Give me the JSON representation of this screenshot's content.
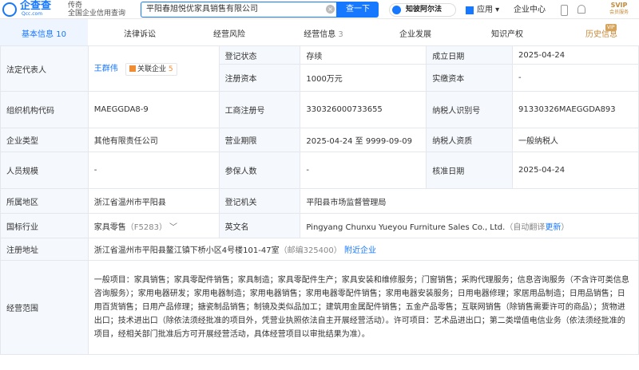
{
  "header": {
    "logo_text": "企查查",
    "logo_sub": "Qcc.com",
    "slogan_1": "传奇",
    "slogan_2": "全国企业信用查询",
    "search_value": "平阳春旭悦优家具销售有限公司",
    "clear_icon": "clear-icon",
    "search_button": "查一下",
    "law_button": "知彼阿尔法",
    "apps_label": "应用",
    "enterprise_center": "企业中心",
    "svip_line1": "SVIP",
    "svip_line2": "会员服务",
    "brand_color": "#1677ff"
  },
  "tabs": [
    {
      "label": "基本信息",
      "count": "10"
    },
    {
      "label": "法律诉讼",
      "count": ""
    },
    {
      "label": "经营风险",
      "count": ""
    },
    {
      "label": "经营信息",
      "count": "3"
    },
    {
      "label": "企业发展",
      "count": ""
    },
    {
      "label": "知识产权",
      "count": ""
    },
    {
      "label": "历史信息",
      "count": ""
    }
  ],
  "vip_badge": "VIP",
  "info": {
    "legal_rep_label": "法定代表人",
    "legal_rep_name": "王群伟",
    "related_label": "关联企业",
    "related_count": "5",
    "status_label": "登记状态",
    "status_value": "存续",
    "est_date_label": "成立日期",
    "est_date_value": "2025-04-24",
    "capital_label": "注册资本",
    "capital_value": "1000万元",
    "paid_label": "实缴资本",
    "paid_value": "-",
    "org_code_label": "组织机构代码",
    "org_code_value": "MAEGGDA8-9",
    "reg_no_label": "工商注册号",
    "reg_no_value": "330326000733655",
    "tax_id_label": "纳税人识别号",
    "tax_id_value": "91330326MAEGGDA893",
    "type_label": "企业类型",
    "type_value": "其他有限责任公司",
    "term_label": "营业期限",
    "term_value": "2025-04-24 至 9999-09-09",
    "tax_qual_label": "纳税人资质",
    "tax_qual_value": "一般纳税人",
    "staff_label": "人员规模",
    "staff_value": "-",
    "insured_label": "参保人数",
    "insured_value": "-",
    "approve_label": "核准日期",
    "approve_value": "2025-04-24",
    "region_label": "所属地区",
    "region_value": "浙江省温州市平阳县",
    "authority_label": "登记机关",
    "authority_value": "平阳县市场监督管理局",
    "industry_label": "国标行业",
    "industry_value": "家具零售",
    "industry_code": "（F5283）",
    "en_name_label": "英文名",
    "en_name_value": "Pingyang Chunxu Yueyou Furniture Sales Co., Ltd.",
    "auto_translate": "（自动翻译更新）",
    "address_label": "注册地址",
    "address_value": "浙江省温州市平阳县鳌江镇下桥小区4号楼101-47室",
    "postcode": "（邮编325400）",
    "nearby": "附近企业",
    "scope_label": "经营范围",
    "scope_value": "一般项目：家具销售；家具零配件销售；家具制造；家具零配件生产；家具安装和维修服务；门窗销售；采购代理服务；信息咨询服务（不含许可类信息咨询服务）；家用电器研发；家用电器制造；家用电器销售；家用电器零配件销售；家用电器安装服务；日用电器修理；家居用品制造；日用品销售；日用百货销售；日用产品修理；搪瓷制品销售；制镜及类似品加工；建筑用金属配件销售；五金产品零售；互联网销售（除销售需要许可的商品）；货物进出口；技术进出口（除依法须经批准的项目外，凭营业执照依法自主开展经营活动）。许可项目：艺术品进出口；第二类增值电信业务（依法须经批准的项目，经相关部门批准后方可开展经营活动，具体经营项目以审批结果为准）。"
  }
}
